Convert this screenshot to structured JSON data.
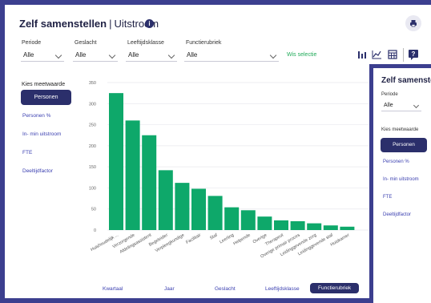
{
  "header": {
    "title_bold": "Zelf samenstellen",
    "separator": "|",
    "title_sub": "Uitstroom",
    "info_icon": "info-icon",
    "print_icon": "printer-icon"
  },
  "filters": [
    {
      "label": "Periode",
      "value": "Alle"
    },
    {
      "label": "Geslacht",
      "value": "Alle"
    },
    {
      "label": "Leeftijdsklasse",
      "value": "Alle"
    },
    {
      "label": "Functierubriek",
      "value": "Alle"
    }
  ],
  "clear_selection": "Wis selectie",
  "toolbar_icons": [
    "bar-chart-icon",
    "line-chart-icon",
    "table-icon",
    "help-icon"
  ],
  "sidebar": {
    "heading": "Kies meetwaarde",
    "items": [
      "Personen",
      "Personen %",
      "In- min uitstroom",
      "FTE",
      "Deeltijdfactor"
    ],
    "active": "Personen"
  },
  "bottom_tabs": [
    "Kwartaal",
    "Jaar",
    "Geslacht",
    "Leeftijdsklasse",
    "Functierubriek"
  ],
  "bottom_active": "Functierubriek",
  "colors": {
    "accent": "#2b2f6b",
    "bar": "#0ea86a",
    "link": "#3a3fb0",
    "clear": "#1faa58"
  },
  "chart_data": {
    "type": "bar",
    "categories": [
      "Huishoudelijk ...",
      "Verzorgende",
      "Afdelingsassistent",
      "Begeleider",
      "Verpleegkundige",
      "Facilitair",
      "Staf",
      "Leerling",
      "Helpende",
      "Overige",
      "Therapeut",
      "Overige primair proces",
      "Leidinggevende zorg",
      "Leidinggevende staf",
      "Huiskamer"
    ],
    "values": [
      325,
      260,
      225,
      142,
      112,
      98,
      81,
      54,
      47,
      32,
      23,
      21,
      16,
      11,
      8
    ],
    "y_ticks": [
      "0",
      "50",
      "100",
      "150",
      "200",
      "250",
      "300",
      "350"
    ],
    "ylim": [
      0,
      350
    ],
    "title": "",
    "xlabel": "",
    "ylabel": ""
  },
  "overlay": {
    "title": "Zelf samenstellen",
    "filter_label": "Periode",
    "filter_value": "Alle",
    "heading": "Kies meetwaarde",
    "items": [
      "Personen",
      "Personen %",
      "In- min uitstroom",
      "FTE",
      "Deeltijdfactor"
    ]
  }
}
